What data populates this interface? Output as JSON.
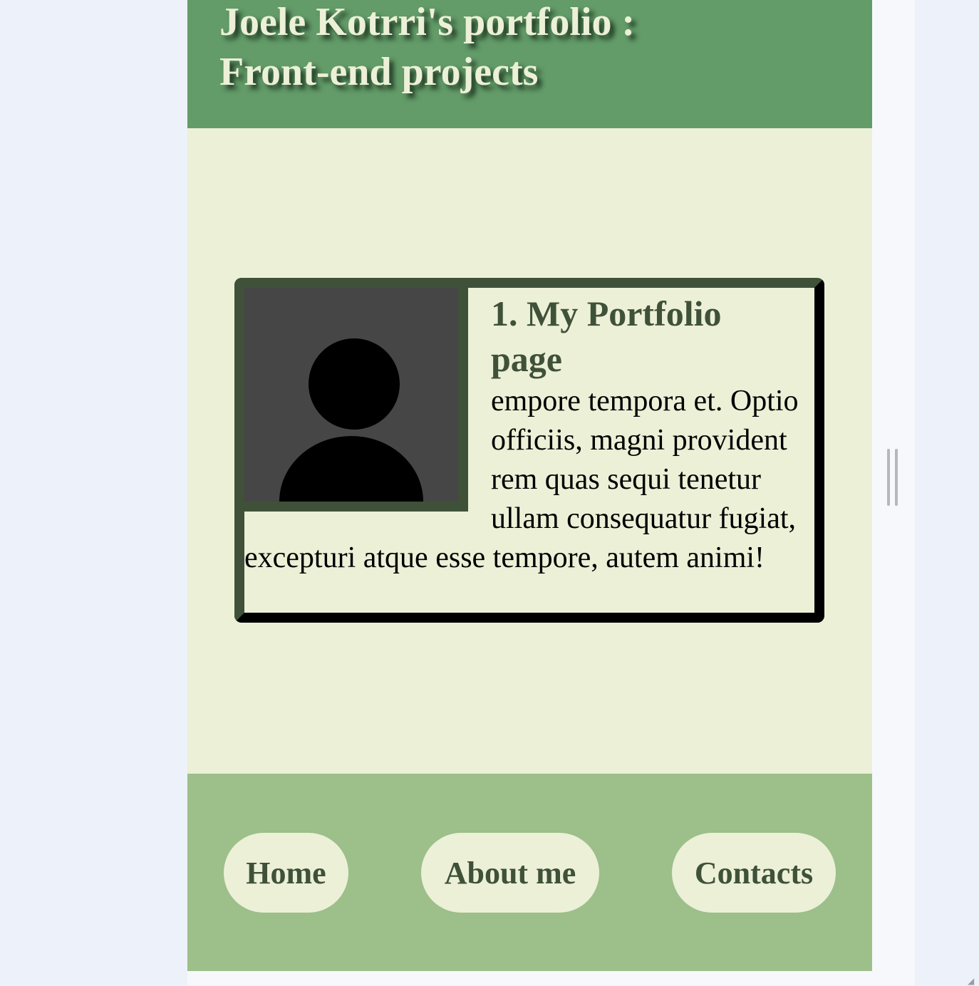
{
  "header": {
    "title_line1": "Joele Kotrri's portfolio :",
    "title_line2": "Front-end projects"
  },
  "project": {
    "image_icon": "avatar-placeholder-icon",
    "title_line1": "1. My Portfolio",
    "title_line2": "page",
    "description": "empore tempora et. Optio officiis, magni provident rem quas sequi tenetur ullam consequatur fugiat, excepturi atque esse tempore, autem animi!"
  },
  "footer": {
    "nav": [
      {
        "label": "Home"
      },
      {
        "label": "About me"
      },
      {
        "label": "Contacts"
      }
    ]
  },
  "colors": {
    "header_bg": "#639b69",
    "content_bg": "#ecf0d7",
    "footer_bg": "#9dbf8a",
    "card_border_dark_green": "#3f5139",
    "card_border_black": "#000000",
    "avatar_bg": "#464646",
    "page_bg": "#edf1f9"
  }
}
